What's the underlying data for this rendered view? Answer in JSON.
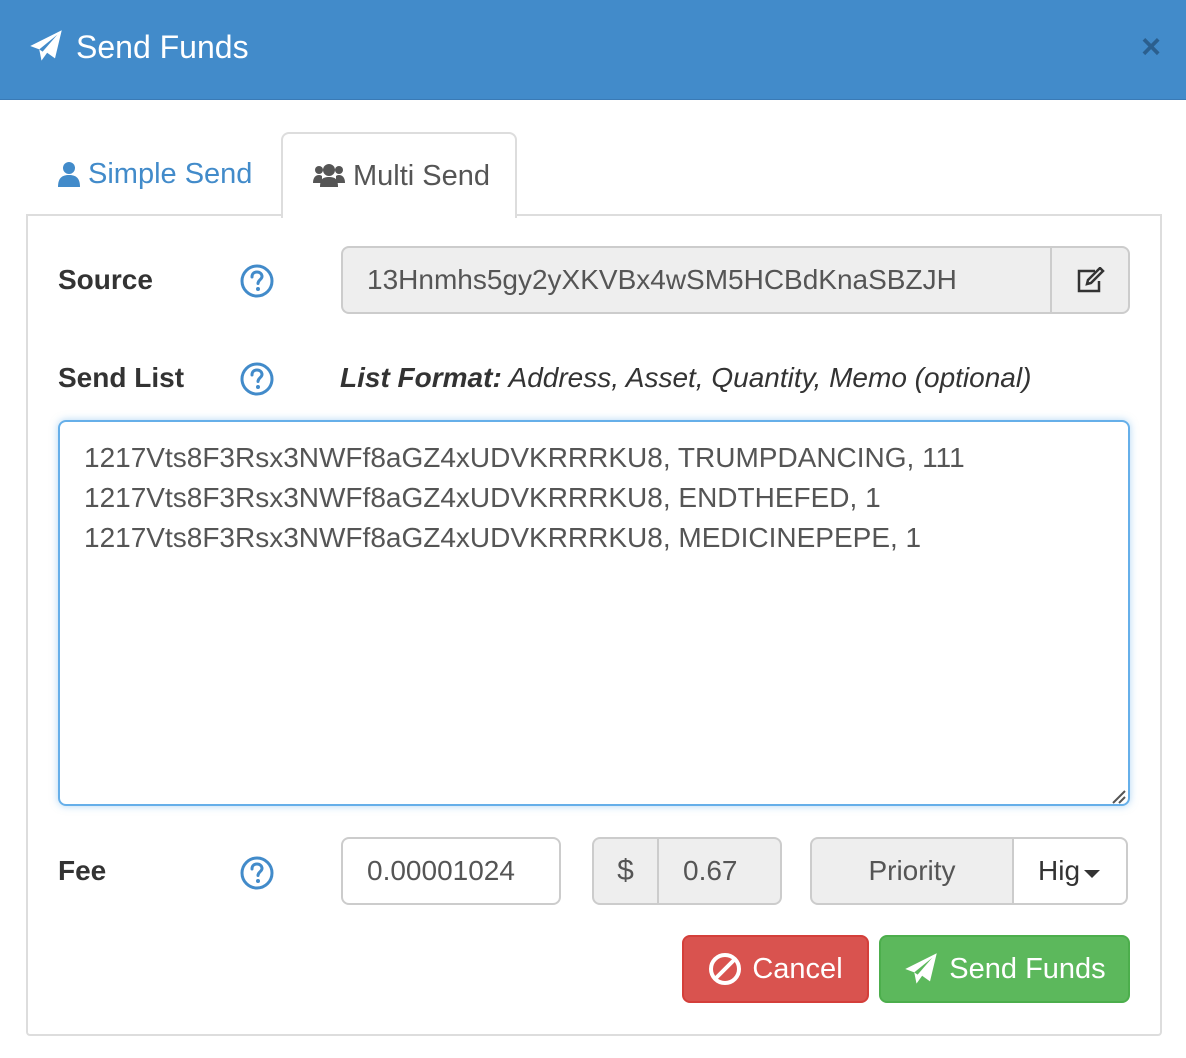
{
  "header": {
    "title": "Send Funds",
    "close_label": "×"
  },
  "tabs": [
    {
      "label": "Simple Send",
      "icon": "user-icon",
      "active": false
    },
    {
      "label": "Multi Send",
      "icon": "users-icon",
      "active": true
    }
  ],
  "source": {
    "label": "Source",
    "value": "13Hnmhs5gy2yXKVBx4wSM5HCBdKnaSBZJH"
  },
  "send_list": {
    "label": "Send List",
    "format_prefix": "List Format:",
    "format_text": "Address, Asset, Quantity, Memo (optional)",
    "value": "1217Vts8F3Rsx3NWFf8aGZ4xUDVKRRRKU8, TRUMPDANCING, 111\n1217Vts8F3Rsx3NWFf8aGZ4xUDVKRRRKU8, ENDTHEFED, 1\n1217Vts8F3Rsx3NWFf8aGZ4xUDVKRRRKU8, MEDICINEPEPE, 1"
  },
  "fee": {
    "label": "Fee",
    "value": "0.00001024",
    "currency_symbol": "$",
    "usd_value": "0.67",
    "priority_label": "Priority",
    "priority_value": "Hig"
  },
  "buttons": {
    "cancel": "Cancel",
    "send": "Send Funds"
  },
  "colors": {
    "header_bg": "#428bca",
    "cancel_bg": "#d9534f",
    "send_bg": "#5cb85c",
    "link": "#428bca"
  }
}
